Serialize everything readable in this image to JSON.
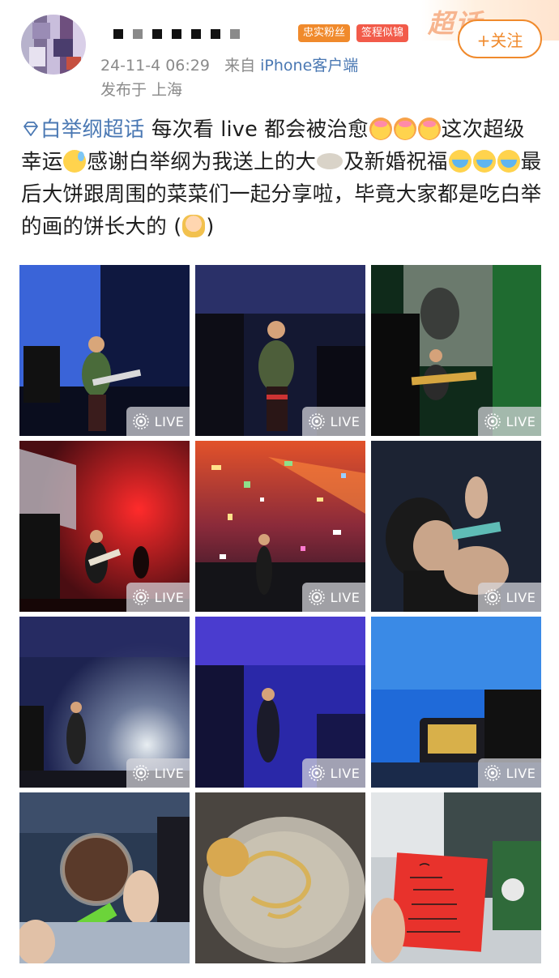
{
  "header": {
    "follow_label": "+关注",
    "badge_fan": "忠实粉丝",
    "badge_event": "签程似锦",
    "supertopic_watermark": "超话",
    "timestamp": "24-11-4 06:29",
    "from_prefix": "来自",
    "source": "iPhone客户端",
    "location": "发布于 上海"
  },
  "post": {
    "topic": "白举纲超话",
    "seg1": "每次看 live 都会被治愈",
    "seg2": "这次超级幸运",
    "seg3": "感谢白举纲为我送上的大",
    "seg4": "及新婚祝福",
    "seg5": "最后大饼跟周围的菜菜们一起分享啦，毕竟大家都是吃白举的画的饼长大的 (",
    "seg6": ")"
  },
  "grid": {
    "live_label": "LIVE",
    "tiles": [
      {
        "live": true
      },
      {
        "live": true
      },
      {
        "live": true
      },
      {
        "live": true
      },
      {
        "live": true
      },
      {
        "live": true
      },
      {
        "live": true
      },
      {
        "live": true
      },
      {
        "live": true
      },
      {
        "live": false
      },
      {
        "live": false
      },
      {
        "live": false
      }
    ]
  },
  "colors": {
    "accent_orange": "#f08a2c",
    "link_blue": "#4a78b3",
    "meta_gray": "#8a8a8a"
  }
}
